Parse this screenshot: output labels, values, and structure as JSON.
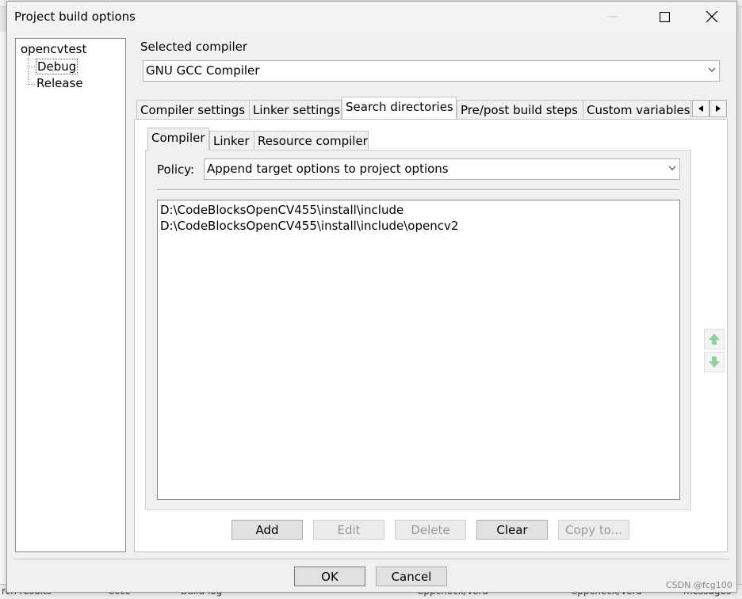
{
  "window": {
    "title": "Project build options",
    "minimize_glyph": "—",
    "maximize_glyph": "☐",
    "close_glyph": "✕"
  },
  "tree": {
    "root": "opencvtest",
    "items": [
      {
        "label": "Debug",
        "selected": true
      },
      {
        "label": "Release",
        "selected": false
      }
    ]
  },
  "compiler": {
    "group_label": "Selected compiler",
    "selected": "GNU GCC Compiler"
  },
  "tabs": [
    {
      "label": "Compiler settings",
      "active": false
    },
    {
      "label": "Linker settings",
      "active": false
    },
    {
      "label": "Search directories",
      "active": true
    },
    {
      "label": "Pre/post build steps",
      "active": false
    },
    {
      "label": "Custom variables",
      "active": false
    }
  ],
  "subtabs": [
    {
      "label": "Compiler",
      "active": true
    },
    {
      "label": "Linker",
      "active": false
    },
    {
      "label": "Resource compiler",
      "active": false
    }
  ],
  "policy": {
    "label": "Policy:",
    "selected": "Append target options to project options"
  },
  "directories": [
    "D:\\CodeBlocksOpenCV455\\install\\include",
    "D:\\CodeBlocksOpenCV455\\install\\include\\opencv2"
  ],
  "dir_buttons": {
    "add": "Add",
    "edit": "Edit",
    "delete": "Delete",
    "clear": "Clear",
    "copy_to": "Copy to..."
  },
  "dialog_buttons": {
    "ok": "OK",
    "cancel": "Cancel"
  },
  "background_tabs": [
    "rch results",
    "Cccc",
    "Build log",
    "Cppcheck/Vera",
    "Cppcheck/Vera",
    "messages"
  ],
  "watermark": "CSDN @fcg100",
  "colors": {
    "move_arrow_green": "#6fc57a"
  }
}
